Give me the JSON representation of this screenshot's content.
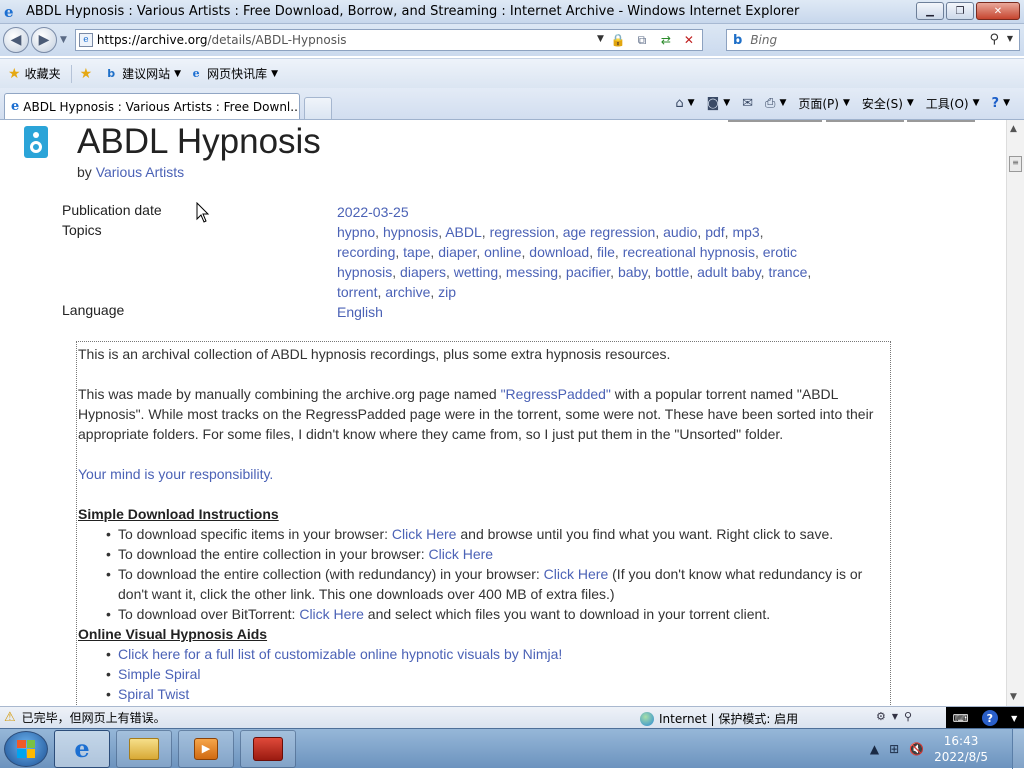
{
  "window": {
    "title": "ABDL Hypnosis : Various Artists : Free Download, Borrow, and Streaming : Internet Archive - Windows Internet Explorer",
    "minimize": "▁",
    "maximize": "❐",
    "close": "✕"
  },
  "address_bar": {
    "url_host": "https://archive.org",
    "url_path": "/details/ABDL-Hypnosis",
    "search_placeholder": "Bing",
    "search_provider": "b"
  },
  "favorites_bar": {
    "favorites_label": "收藏夹",
    "suggested_sites_label": "建议网站",
    "web_slice_label": "网页快讯库"
  },
  "tab": {
    "label": "ABDL Hypnosis : Various Artists : Free Downl..."
  },
  "command_bar": {
    "page_label": "页面(P)",
    "safety_label": "安全(S)",
    "tools_label": "工具(O)"
  },
  "page": {
    "title": "ABDL Hypnosis",
    "by_prefix": "by",
    "creator": "Various Artists",
    "metadata": [
      {
        "key": "Publication date",
        "value": "2022-03-25"
      },
      {
        "key": "Topics",
        "tags": [
          "hypno",
          "hypnosis",
          "ABDL",
          "regression",
          "age regression",
          "audio",
          "pdf",
          "mp3",
          "recording",
          "tape",
          "diaper",
          "online",
          "download",
          "file",
          "recreational hypnosis",
          "erotic hypnosis",
          "diapers",
          "wetting",
          "messing",
          "pacifier",
          "baby",
          "bottle",
          "adult baby",
          "trance",
          "torrent",
          "archive",
          "zip"
        ]
      },
      {
        "key": "Language",
        "value": "English"
      }
    ],
    "description": {
      "intro": "This is an archival collection of ABDL hypnosis recordings, plus some extra hypnosis resources.",
      "para2_before": "This was made by manually combining the archive.org page named ",
      "para2_link": "\"RegressPadded\"",
      "para2_after": " with a popular torrent named \"ABDL Hypnosis\". While most tracks on the RegressPadded page were in the torrent, some were not. These have been sorted into their appropriate folders. For some files, I didn't know where they came from, so I just put them in the \"Unsorted\" folder.",
      "responsibility": "Your mind is your responsibility.",
      "download_header": "Simple Download Instructions",
      "download_items": [
        {
          "before": "To download specific items in your browser: ",
          "link": "Click Here",
          "after": " and browse until you find what you want. Right click to save."
        },
        {
          "before": "To download the entire collection in your browser: ",
          "link": "Click Here",
          "after": ""
        },
        {
          "before": "To download the entire collection (with redundancy) in your browser: ",
          "link": "Click Here",
          "after": " (If you don't know what redundancy is or don't want it, click the other link. This one downloads over 400 MB of extra files.)"
        },
        {
          "before": "To download over BitTorrent: ",
          "link": "Click Here",
          "after": " and select which files you want to download in your torrent client."
        }
      ],
      "visual_header": "Online Visual Hypnosis Aids",
      "visual_items": [
        "Click here for a full list of customizable online hypnotic visuals by Nimja!",
        "Simple Spiral",
        "Spiral Twist"
      ]
    }
  },
  "status_bar": {
    "message": "已完毕，但网页上有错误。",
    "zone": "Internet | 保护模式: 启用"
  },
  "taskbar": {
    "time": "16:43",
    "date": "2022/8/5"
  }
}
